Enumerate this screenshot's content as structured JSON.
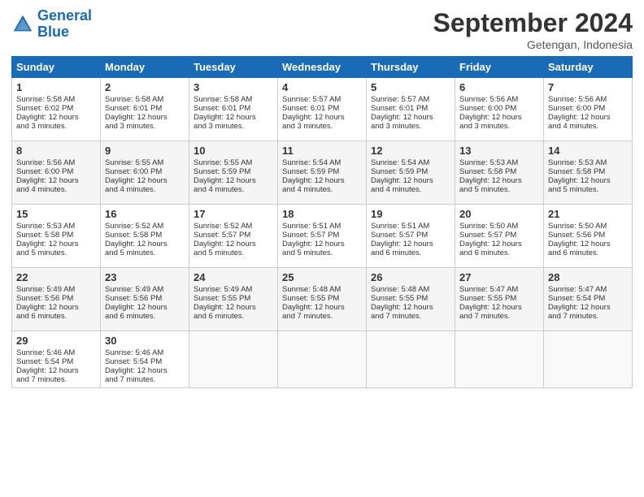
{
  "logo": {
    "line1": "General",
    "line2": "Blue"
  },
  "title": "September 2024",
  "location": "Getengan, Indonesia",
  "days_of_week": [
    "Sunday",
    "Monday",
    "Tuesday",
    "Wednesday",
    "Thursday",
    "Friday",
    "Saturday"
  ],
  "weeks": [
    [
      {
        "day": "1",
        "rise": "Sunrise: 5:58 AM",
        "set": "Sunset: 6:02 PM",
        "daylight": "Daylight: 12 hours and 3 minutes."
      },
      {
        "day": "2",
        "rise": "Sunrise: 5:58 AM",
        "set": "Sunset: 6:01 PM",
        "daylight": "Daylight: 12 hours and 3 minutes."
      },
      {
        "day": "3",
        "rise": "Sunrise: 5:58 AM",
        "set": "Sunset: 6:01 PM",
        "daylight": "Daylight: 12 hours and 3 minutes."
      },
      {
        "day": "4",
        "rise": "Sunrise: 5:57 AM",
        "set": "Sunset: 6:01 PM",
        "daylight": "Daylight: 12 hours and 3 minutes."
      },
      {
        "day": "5",
        "rise": "Sunrise: 5:57 AM",
        "set": "Sunset: 6:01 PM",
        "daylight": "Daylight: 12 hours and 3 minutes."
      },
      {
        "day": "6",
        "rise": "Sunrise: 5:56 AM",
        "set": "Sunset: 6:00 PM",
        "daylight": "Daylight: 12 hours and 3 minutes."
      },
      {
        "day": "7",
        "rise": "Sunrise: 5:56 AM",
        "set": "Sunset: 6:00 PM",
        "daylight": "Daylight: 12 hours and 4 minutes."
      }
    ],
    [
      {
        "day": "8",
        "rise": "Sunrise: 5:56 AM",
        "set": "Sunset: 6:00 PM",
        "daylight": "Daylight: 12 hours and 4 minutes."
      },
      {
        "day": "9",
        "rise": "Sunrise: 5:55 AM",
        "set": "Sunset: 6:00 PM",
        "daylight": "Daylight: 12 hours and 4 minutes."
      },
      {
        "day": "10",
        "rise": "Sunrise: 5:55 AM",
        "set": "Sunset: 5:59 PM",
        "daylight": "Daylight: 12 hours and 4 minutes."
      },
      {
        "day": "11",
        "rise": "Sunrise: 5:54 AM",
        "set": "Sunset: 5:59 PM",
        "daylight": "Daylight: 12 hours and 4 minutes."
      },
      {
        "day": "12",
        "rise": "Sunrise: 5:54 AM",
        "set": "Sunset: 5:59 PM",
        "daylight": "Daylight: 12 hours and 4 minutes."
      },
      {
        "day": "13",
        "rise": "Sunrise: 5:53 AM",
        "set": "Sunset: 5:58 PM",
        "daylight": "Daylight: 12 hours and 5 minutes."
      },
      {
        "day": "14",
        "rise": "Sunrise: 5:53 AM",
        "set": "Sunset: 5:58 PM",
        "daylight": "Daylight: 12 hours and 5 minutes."
      }
    ],
    [
      {
        "day": "15",
        "rise": "Sunrise: 5:53 AM",
        "set": "Sunset: 5:58 PM",
        "daylight": "Daylight: 12 hours and 5 minutes."
      },
      {
        "day": "16",
        "rise": "Sunrise: 5:52 AM",
        "set": "Sunset: 5:58 PM",
        "daylight": "Daylight: 12 hours and 5 minutes."
      },
      {
        "day": "17",
        "rise": "Sunrise: 5:52 AM",
        "set": "Sunset: 5:57 PM",
        "daylight": "Daylight: 12 hours and 5 minutes."
      },
      {
        "day": "18",
        "rise": "Sunrise: 5:51 AM",
        "set": "Sunset: 5:57 PM",
        "daylight": "Daylight: 12 hours and 5 minutes."
      },
      {
        "day": "19",
        "rise": "Sunrise: 5:51 AM",
        "set": "Sunset: 5:57 PM",
        "daylight": "Daylight: 12 hours and 6 minutes."
      },
      {
        "day": "20",
        "rise": "Sunrise: 5:50 AM",
        "set": "Sunset: 5:57 PM",
        "daylight": "Daylight: 12 hours and 6 minutes."
      },
      {
        "day": "21",
        "rise": "Sunrise: 5:50 AM",
        "set": "Sunset: 5:56 PM",
        "daylight": "Daylight: 12 hours and 6 minutes."
      }
    ],
    [
      {
        "day": "22",
        "rise": "Sunrise: 5:49 AM",
        "set": "Sunset: 5:56 PM",
        "daylight": "Daylight: 12 hours and 6 minutes."
      },
      {
        "day": "23",
        "rise": "Sunrise: 5:49 AM",
        "set": "Sunset: 5:56 PM",
        "daylight": "Daylight: 12 hours and 6 minutes."
      },
      {
        "day": "24",
        "rise": "Sunrise: 5:49 AM",
        "set": "Sunset: 5:55 PM",
        "daylight": "Daylight: 12 hours and 6 minutes."
      },
      {
        "day": "25",
        "rise": "Sunrise: 5:48 AM",
        "set": "Sunset: 5:55 PM",
        "daylight": "Daylight: 12 hours and 7 minutes."
      },
      {
        "day": "26",
        "rise": "Sunrise: 5:48 AM",
        "set": "Sunset: 5:55 PM",
        "daylight": "Daylight: 12 hours and 7 minutes."
      },
      {
        "day": "27",
        "rise": "Sunrise: 5:47 AM",
        "set": "Sunset: 5:55 PM",
        "daylight": "Daylight: 12 hours and 7 minutes."
      },
      {
        "day": "28",
        "rise": "Sunrise: 5:47 AM",
        "set": "Sunset: 5:54 PM",
        "daylight": "Daylight: 12 hours and 7 minutes."
      }
    ],
    [
      {
        "day": "29",
        "rise": "Sunrise: 5:46 AM",
        "set": "Sunset: 5:54 PM",
        "daylight": "Daylight: 12 hours and 7 minutes."
      },
      {
        "day": "30",
        "rise": "Sunrise: 5:46 AM",
        "set": "Sunset: 5:54 PM",
        "daylight": "Daylight: 12 hours and 7 minutes."
      },
      null,
      null,
      null,
      null,
      null
    ]
  ]
}
